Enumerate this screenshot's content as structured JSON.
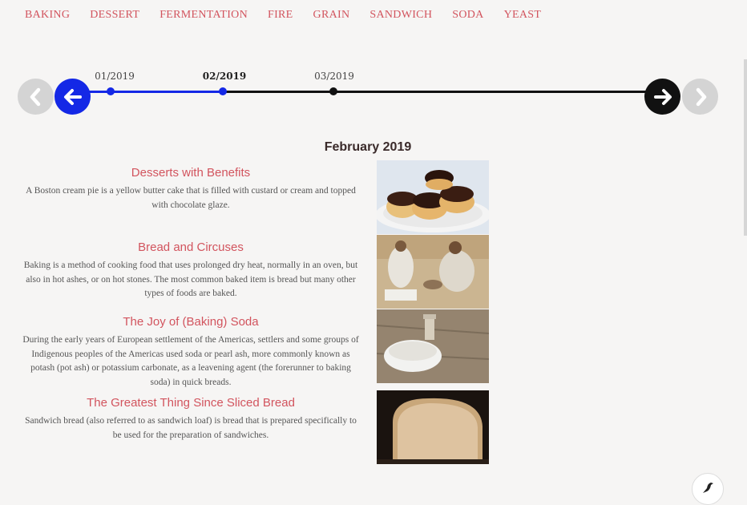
{
  "nav": {
    "items": [
      "BAKING",
      "DESSERT",
      "FERMENTATION",
      "FIRE",
      "GRAIN",
      "SANDWICH",
      "SODA",
      "YEAST"
    ]
  },
  "timeline": {
    "dates": [
      "01/2019",
      "02/2019",
      "03/2019"
    ],
    "active_index": 1,
    "first_icon": "chevron-left-icon",
    "prev_icon": "arrow-left-icon",
    "next_icon": "arrow-right-icon",
    "last_icon": "chevron-right-icon",
    "colors": {
      "active": "#1428e6",
      "line": "#111111",
      "disabled": "#d4d4d4"
    }
  },
  "month_title": "February 2019",
  "stories": [
    {
      "title": "Desserts with Benefits",
      "body": "A Boston cream pie is a yellow butter cake that is filled with custard or cream and topped with chocolate glaze.",
      "image": "cream-puffs-photo"
    },
    {
      "title": "Bread and Circuses",
      "body": "Baking is a method of cooking food that uses prolonged dry heat, normally in an oven, but also in hot ashes, or on hot stones. The most common baked item is bread but many other types of foods are baked.",
      "image": "bakers-in-desert-photo"
    },
    {
      "title": "The Joy of (Baking) Soda",
      "body": "During the early years of European settlement of the Americas, settlers and some groups of Indigenous peoples of the Americas used soda or pearl ash, more commonly known as potash (pot ash) or potassium carbonate, as a leavening agent (the forerunner to baking soda) in quick breads.",
      "image": "baking-soda-bowl-photo"
    },
    {
      "title": "The Greatest Thing Since Sliced Bread",
      "body": "Sandwich bread (also referred to as sandwich loaf) is bread that is prepared specifically to be used for the preparation of sandwiches.",
      "image": "bread-loaf-photo"
    }
  ],
  "accent_color": "#d2545e"
}
